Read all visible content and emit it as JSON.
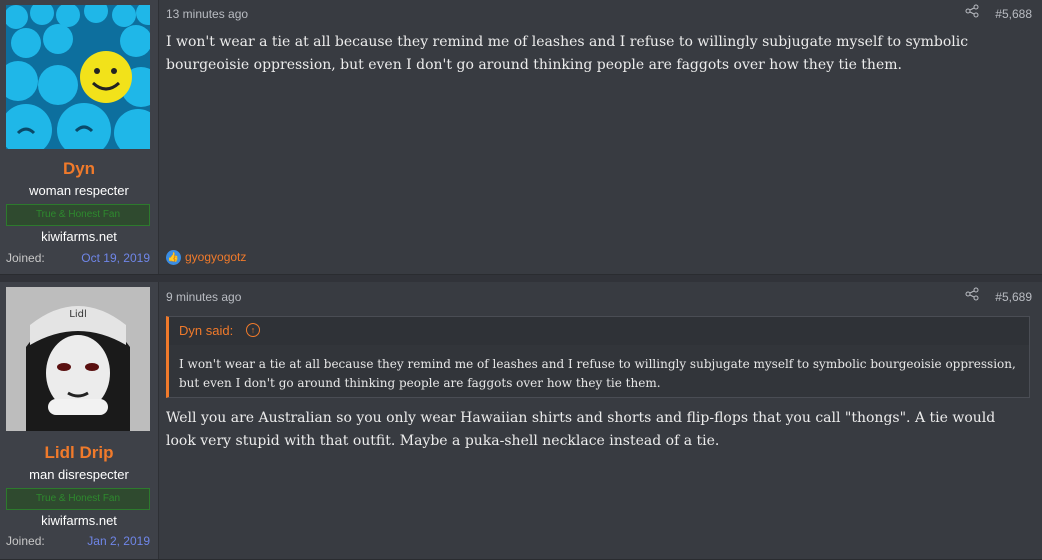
{
  "posts": [
    {
      "user": {
        "name": "Dyn",
        "title": "woman respecter",
        "banner": "True & Honest Fan",
        "site": "kiwifarms.net",
        "joined_label": "Joined:",
        "joined_date": "Oct 19, 2019"
      },
      "time": "13 minutes ago",
      "number": "#5,688",
      "share_icon": "share-icon",
      "body": "I won't wear a tie at all because they remind me of leashes and I refuse to willingly subjugate myself to symbolic bourgeoisie oppression, but even I don't go around thinking people are faggots over how they tie them.",
      "reaction": {
        "icon": "like-icon",
        "user": "gyogyogotz"
      }
    },
    {
      "user": {
        "name": "Lidl Drip",
        "title": "man disrespecter",
        "banner": "True & Honest Fan",
        "site": "kiwifarms.net",
        "joined_label": "Joined:",
        "joined_date": "Jan 2, 2019"
      },
      "time": "9 minutes ago",
      "number": "#5,689",
      "share_icon": "share-icon",
      "quote": {
        "attribution": "Dyn said:",
        "text": "I won't wear a tie at all because they remind me of leashes and I refuse to willingly subjugate myself to symbolic bourgeoisie oppression, but even I don't go around thinking people are faggots over how they tie them."
      },
      "body": "Well you are Australian so you only wear Hawaiian shirts and shorts and flip-flops that you call \"thongs\". A tie would look very stupid with that outfit. Maybe a puka-shell necklace instead of a tie."
    }
  ],
  "colors": {
    "accent": "#f07a2b",
    "joined_date": "#6f86e8",
    "banner_green": "#2e8a2e",
    "background": "#383b41"
  }
}
